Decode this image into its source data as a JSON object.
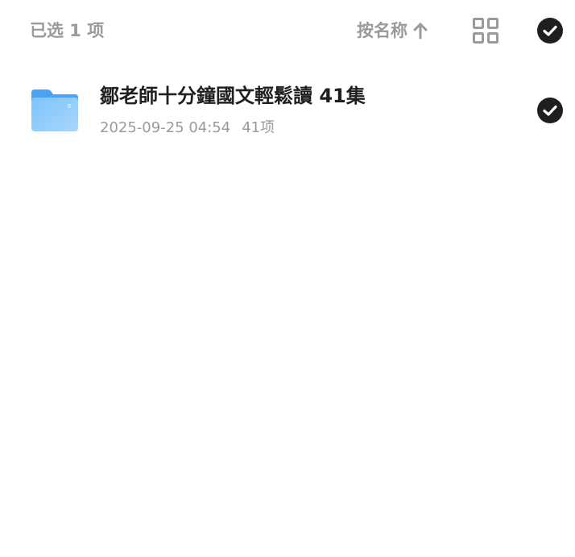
{
  "header": {
    "selected_text": "已选 1 项",
    "sort_label": "按名称",
    "sort_icon": "arrow-up-icon",
    "view_toggle_icon": "grid-view-icon",
    "select_all_icon": "check-circle-icon"
  },
  "files": [
    {
      "name": "鄒老師十分鐘國文輕鬆讀 41集",
      "date": "2025-09-25 04:54",
      "count": "41项",
      "icon": "folder-icon",
      "selected": true
    }
  ],
  "colors": {
    "muted_text": "#9a9a9a",
    "primary_text": "#1f1f1f",
    "check_fill": "#1f1f1f",
    "folder_blue": "#6cb8f5"
  }
}
